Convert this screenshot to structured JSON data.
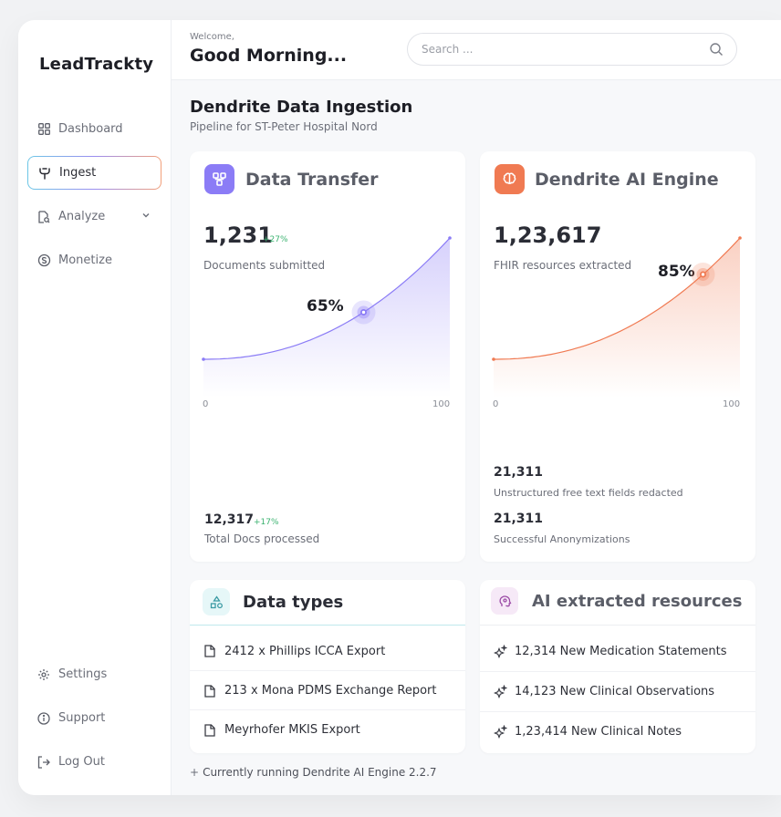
{
  "app": {
    "logo": "LeadTrackty"
  },
  "sidebar": {
    "items": [
      {
        "label": "Dashboard",
        "icon": "grid-icon"
      },
      {
        "label": "Ingest",
        "icon": "fork-icon",
        "active": true
      },
      {
        "label": "Analyze",
        "icon": "report-icon"
      },
      {
        "label": "Monetize",
        "icon": "coin-icon"
      }
    ],
    "bottom": [
      {
        "label": "Settings",
        "icon": "gear-icon"
      },
      {
        "label": "Support",
        "icon": "info-icon"
      },
      {
        "label": "Log Out",
        "icon": "logout-icon"
      }
    ]
  },
  "header": {
    "welcome": "Welcome,",
    "greeting": "Good Morning...",
    "search_placeholder": "Search ..."
  },
  "page": {
    "title": "Dendrite Data Ingestion",
    "subtitle": "Pipeline for ST-Peter Hospital Nord"
  },
  "transfer": {
    "title": "Data Transfer",
    "value": "1,231",
    "delta": "+27%",
    "label": "Documents submitted",
    "percent": "65%",
    "x_min": "0",
    "x_max": "100",
    "total_value": "12,317",
    "total_delta": "+17%",
    "total_label": "Total Docs processed",
    "accent": "#8b7cf6"
  },
  "engine": {
    "title": "Dendrite AI Engine",
    "value": "1,23,617",
    "label": "FHIR resources extracted",
    "percent": "85%",
    "x_min": "0",
    "x_max": "100",
    "stat1_value": "21,311",
    "stat1_label": "Unstructured free text fields redacted",
    "stat2_value": "21,311",
    "stat2_label": "Successful Anonymizations",
    "accent": "#f07a52"
  },
  "chart_data": [
    {
      "type": "area",
      "x": [
        0,
        65,
        100
      ],
      "marker": {
        "x": 65,
        "label": "65%"
      },
      "xlim": [
        0,
        100
      ],
      "color": "#8b7cf6"
    },
    {
      "type": "area",
      "x": [
        0,
        85,
        100
      ],
      "marker": {
        "x": 85,
        "label": "85%"
      },
      "xlim": [
        0,
        100
      ],
      "color": "#f07a52"
    }
  ],
  "datatypes": {
    "title": "Data types",
    "rows": [
      "2412 x Phillips ICCA Export",
      "213 x Mona PDMS Exchange Report",
      "Meyrhofer MKIS Export"
    ]
  },
  "resources": {
    "title": "AI extracted resources",
    "rows": [
      "12,314 New Medication Statements",
      "14,123 New Clinical Observations",
      "1,23,414 New Clinical Notes"
    ]
  },
  "footer": {
    "prefix": "+",
    "text": "Currently running  Dendrite AI Engine 2.2.7"
  }
}
